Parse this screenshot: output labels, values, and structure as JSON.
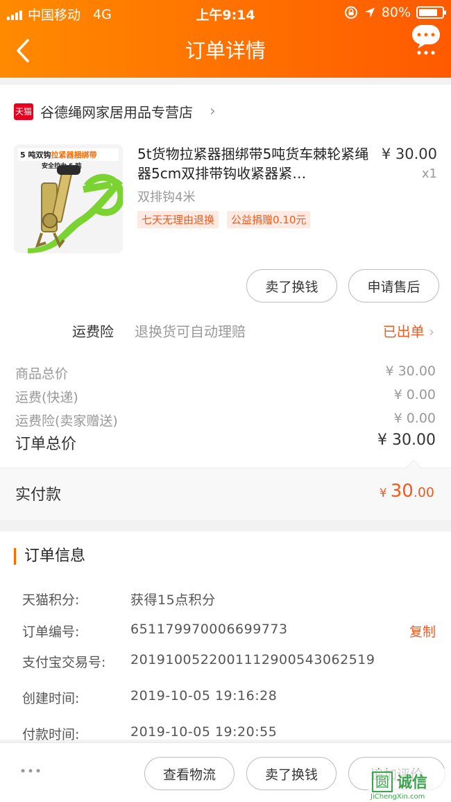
{
  "status_bar": {
    "carrier": "中国移动",
    "network": "4G",
    "time": "上午9:14",
    "battery": "80%",
    "battery_level": 0.8
  },
  "header": {
    "title": "订单详情"
  },
  "shop": {
    "badge": "天猫",
    "name": "谷德绳网家居用品专营店"
  },
  "product": {
    "image_text_1": "5 吨双钩",
    "image_text_2": "拉紧器捆绑带",
    "image_text_3": "安全拉力 5 吨",
    "title": "5t货物拉紧器捆绑带5吨货车棘轮紧绳器5cm双排带钩收紧器紧…",
    "price": "¥ 30.00",
    "quantity": "x1",
    "sku": "双排钩4米",
    "tags": [
      "七天无理由退换",
      "公益捐赠0.10元"
    ]
  },
  "actions": {
    "sell_label": "卖了换钱",
    "after_sale_label": "申请售后"
  },
  "insurance": {
    "label": "运费险",
    "desc": "退换货可自动理赔",
    "status": "已出单"
  },
  "fees": [
    {
      "label": "商品总价",
      "value": "¥ 30.00"
    },
    {
      "label": "运费(快递)",
      "value": "¥ 0.00"
    },
    {
      "label": "运费险(卖家赠送)",
      "value": "¥ 0.00"
    }
  ],
  "total": {
    "label": "订单总价",
    "value": "¥ 30.00"
  },
  "paid": {
    "label": "实付款",
    "symbol": "¥",
    "int": "30",
    "dec": ".00"
  },
  "order_info": {
    "title": "订单信息",
    "rows": [
      {
        "key": "天猫积分:",
        "value": "获得15点积分"
      },
      {
        "key": "订单编号:",
        "value": "651179970006699773",
        "action": "复制"
      },
      {
        "key": "支付宝交易号:",
        "value": "2019100522001112900543062519"
      },
      {
        "key": "创建时间:",
        "value": "2019-10-05 19:16:28"
      },
      {
        "key": "付款时间:",
        "value": "2019-10-05 19:20:55"
      }
    ]
  },
  "bottom_bar": {
    "logistics_label": "查看物流",
    "sell_label": "卖了换钱",
    "review_label": "追加评价"
  },
  "watermark": {
    "text": "诚信",
    "icon_char": "圆",
    "url": "JiChengXin.com"
  },
  "colors": {
    "header_start": "#ff8a00",
    "header_end": "#ff5a00",
    "accent": "#f35a1f",
    "tmall_red": "#e9001e"
  }
}
